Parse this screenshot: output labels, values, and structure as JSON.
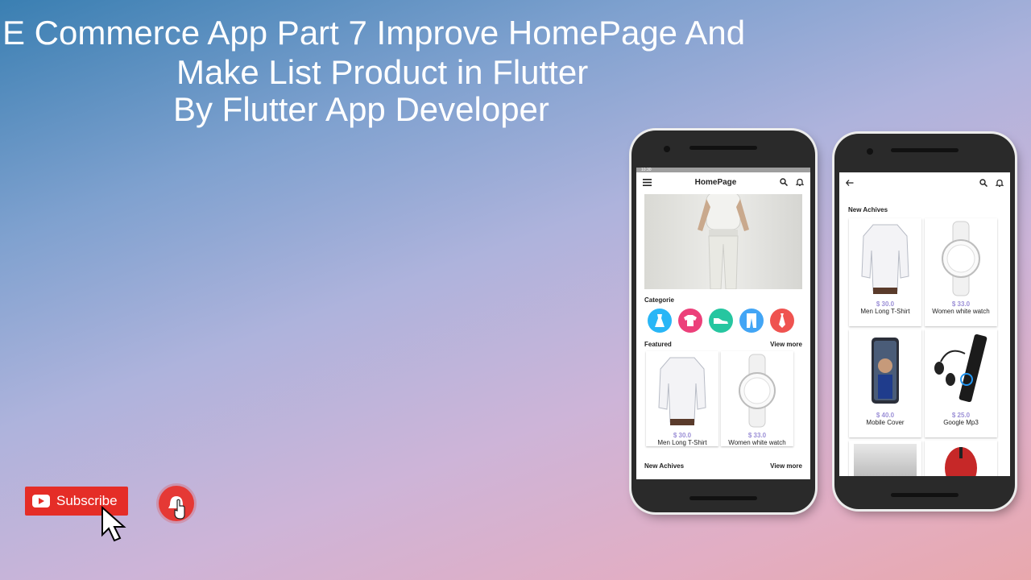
{
  "video": {
    "title_line1": "E Commerce App Part 7 Improve  HomePage And",
    "title_line2": "Make List Product in Flutter",
    "title_line3": "By Flutter App Developer",
    "subscribe_label": "Subscribe"
  },
  "phone1": {
    "statusbar": "10:30",
    "appbar_title": "HomePage",
    "categories_title": "Categorie",
    "categories": [
      {
        "icon": "dress-icon",
        "color": "#29b6f6"
      },
      {
        "icon": "tshirt-icon",
        "color": "#ec407a"
      },
      {
        "icon": "shoe-icon",
        "color": "#26c6a0"
      },
      {
        "icon": "pants-icon",
        "color": "#42a5f5"
      },
      {
        "icon": "tie-icon",
        "color": "#ef5350"
      }
    ],
    "featured_title": "Featured",
    "featured_view_more": "View more",
    "featured": [
      {
        "price": "$ 30.0",
        "name": "Men Long T-Shirt"
      },
      {
        "price": "$ 33.0",
        "name": "Women white watch"
      }
    ],
    "new_title": "New Achives",
    "new_view_more": "View more"
  },
  "phone2": {
    "section_title": "New Achives",
    "products": [
      {
        "price": "$ 30.0",
        "name": "Men Long T-Shirt"
      },
      {
        "price": "$ 33.0",
        "name": "Women white watch"
      },
      {
        "price": "$ 40.0",
        "name": "Mobile Cover"
      },
      {
        "price": "$ 25.0",
        "name": "Google Mp3"
      }
    ]
  },
  "colors": {
    "accent_price": "#9b8fd6",
    "youtube_red": "#e52d27"
  }
}
